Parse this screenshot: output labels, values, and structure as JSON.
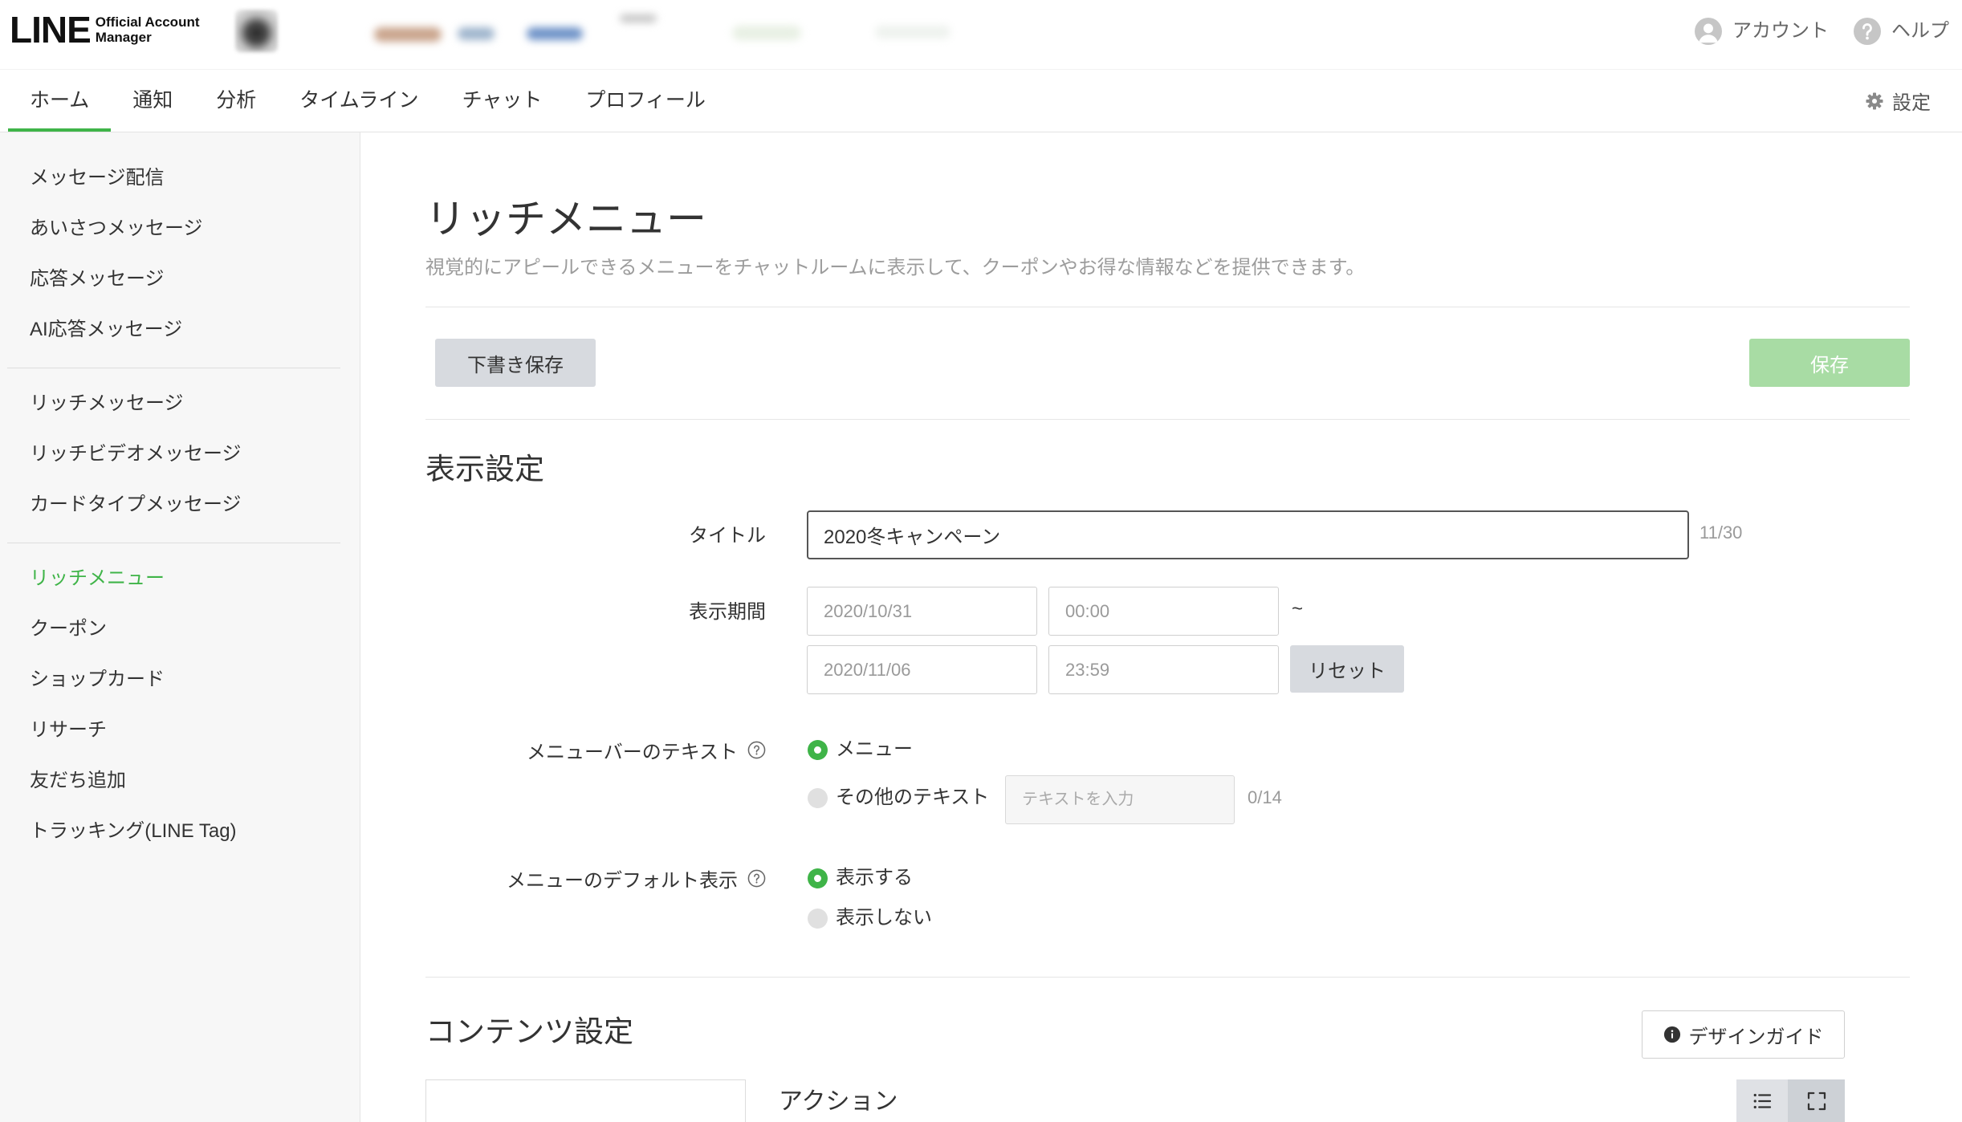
{
  "header": {
    "logo_main": "LINE",
    "logo_sub_line1": "Official Account",
    "logo_sub_line2": "Manager",
    "account_label": "アカウント",
    "help_label": "ヘルプ"
  },
  "nav": {
    "tabs": [
      {
        "label": "ホーム",
        "active": true
      },
      {
        "label": "通知",
        "active": false
      },
      {
        "label": "分析",
        "active": false
      },
      {
        "label": "タイムライン",
        "active": false
      },
      {
        "label": "チャット",
        "active": false
      },
      {
        "label": "プロフィール",
        "active": false
      }
    ],
    "settings_label": "設定"
  },
  "sidebar": {
    "groups": [
      {
        "items": [
          {
            "label": "メッセージ配信",
            "active": false
          },
          {
            "label": "あいさつメッセージ",
            "active": false
          },
          {
            "label": "応答メッセージ",
            "active": false
          },
          {
            "label": "AI応答メッセージ",
            "active": false
          }
        ]
      },
      {
        "items": [
          {
            "label": "リッチメッセージ",
            "active": false
          },
          {
            "label": "リッチビデオメッセージ",
            "active": false
          },
          {
            "label": "カードタイプメッセージ",
            "active": false
          }
        ]
      },
      {
        "items": [
          {
            "label": "リッチメニュー",
            "active": true
          },
          {
            "label": "クーポン",
            "active": false
          },
          {
            "label": "ショップカード",
            "active": false
          },
          {
            "label": "リサーチ",
            "active": false
          },
          {
            "label": "友だち追加",
            "active": false
          },
          {
            "label": "トラッキング(LINE Tag)",
            "active": false
          }
        ]
      }
    ]
  },
  "main": {
    "title": "リッチメニュー",
    "subtitle": "視覚的にアピールできるメニューをチャットルームに表示して、クーポンやお得な情報などを提供できます。",
    "draft_button": "下書き保存",
    "save_button": "保存",
    "display_settings": {
      "heading": "表示設定",
      "title": {
        "label": "タイトル",
        "value": "2020冬キャンペーン",
        "count": "11/30"
      },
      "period": {
        "label": "表示期間",
        "start_date": "2020/10/31",
        "start_time": "00:00",
        "separator": "~",
        "end_date": "2020/11/06",
        "end_time": "23:59",
        "reset_button": "リセット"
      },
      "menubar_text": {
        "label": "メニューバーのテキスト",
        "options": [
          {
            "label": "メニュー",
            "selected": true
          },
          {
            "label": "その他のテキスト",
            "selected": false
          }
        ],
        "other_placeholder": "テキストを入力",
        "other_count": "0/14"
      },
      "default_display": {
        "label": "メニューのデフォルト表示",
        "options": [
          {
            "label": "表示する",
            "selected": true
          },
          {
            "label": "表示しない",
            "selected": false
          }
        ]
      }
    },
    "content_settings": {
      "heading": "コンテンツ設定",
      "design_guide_button": "デザインガイド",
      "action_label": "アクション"
    }
  },
  "icons": {
    "account": "account-icon",
    "help": "help-icon",
    "settings": "gear-icon",
    "tooltip": "question-circle-icon",
    "info": "info-icon",
    "list_view": "list-icon",
    "fullscreen": "fullscreen-icon"
  },
  "colors": {
    "accent": "#3fb448",
    "save_button_bg": "#a8dca4",
    "button_gray": "#d7dadf",
    "text": "#333333",
    "muted": "#9c9c9c"
  }
}
